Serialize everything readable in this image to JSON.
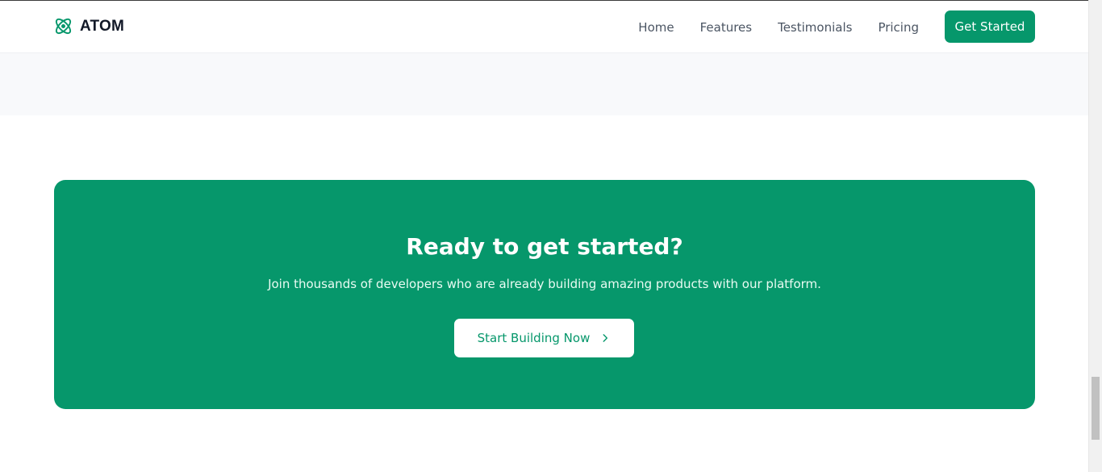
{
  "brand": {
    "name": "ATOM",
    "icon": "atom-icon"
  },
  "nav": {
    "links": [
      "Home",
      "Features",
      "Testimonials",
      "Pricing"
    ],
    "cta_label": "Get Started"
  },
  "cta": {
    "title": "Ready to get started?",
    "subtitle": "Join thousands of developers who are already building amazing products with our platform.",
    "button_label": "Start Building Now",
    "button_icon": "chevron-right-icon"
  },
  "colors": {
    "accent": "#06976b",
    "nav_text": "#4b5563",
    "brand_text": "#111827",
    "section_bg": "#f8f9fb"
  }
}
